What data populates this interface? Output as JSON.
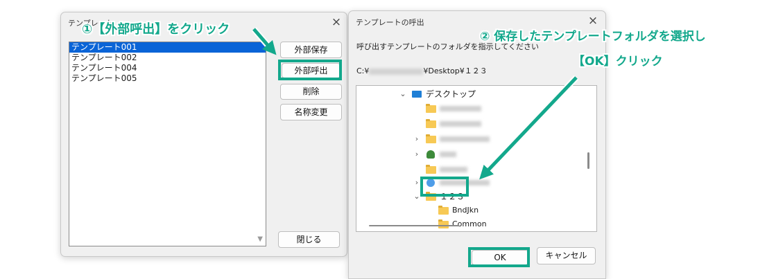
{
  "left_dialog": {
    "title": "テンプレート",
    "close_icon": "×",
    "templates": [
      "テンプレート001",
      "テンプレート002",
      "テンプレート004",
      "テンプレート005"
    ],
    "selected_index": 0,
    "buttons": {
      "export": "外部保存",
      "import": "外部呼出",
      "delete": "削除",
      "rename": "名称変更",
      "close": "閉じる"
    },
    "scroll_arrow": "▼"
  },
  "right_dialog": {
    "title": "テンプレートの呼出",
    "close_icon": "×",
    "instruction": "呼び出すテンプレートのフォルダを指示してください",
    "path_prefix": "C:¥",
    "path_suffix": "¥Desktop¥１２３",
    "tree": {
      "desktop_label": "デスクトップ",
      "selected_folder": "１２３",
      "children": [
        "BndJkn",
        "Common"
      ]
    },
    "buttons": {
      "ok": "OK",
      "cancel": "キャンセル"
    }
  },
  "annotations": {
    "step1": "①【外部呼出】をクリック",
    "step2_line1": "② 保存したテンプレートフォルダを選択し",
    "step2_line2": "【OK】クリック"
  },
  "colors": {
    "accent": "#13a88c",
    "selection": "#0a64d7"
  }
}
